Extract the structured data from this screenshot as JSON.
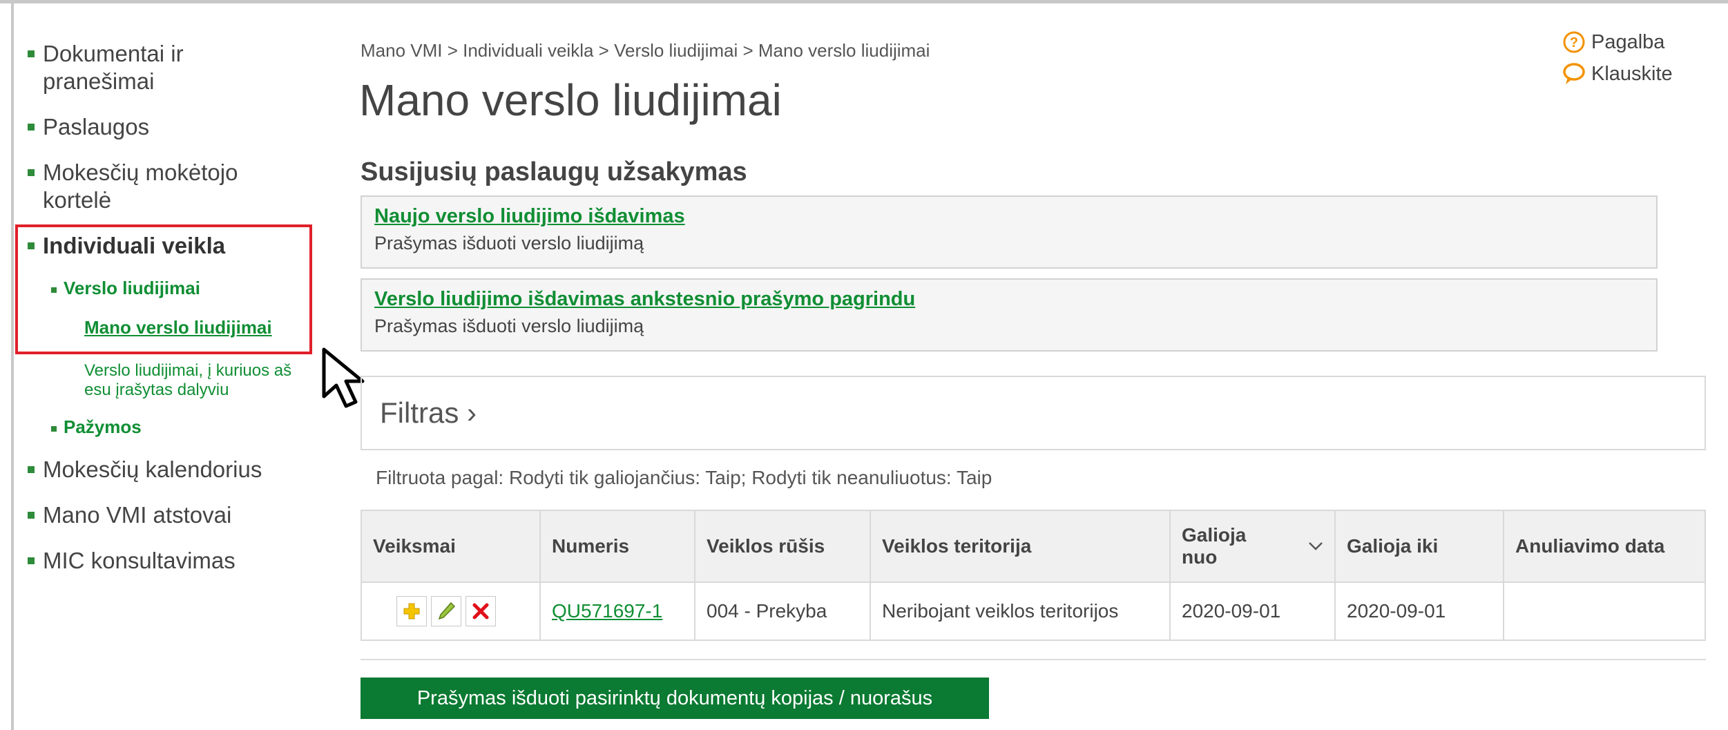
{
  "sidebar": {
    "items": [
      {
        "label": "Dokumentai ir pranešimai"
      },
      {
        "label": "Paslaugos"
      },
      {
        "label": "Mokesčių mokėtojo kortelė"
      },
      {
        "label": "Individuali veikla"
      },
      {
        "label": "Versl​o liudijimai"
      },
      {
        "label": "Mano verslo liudijimai"
      },
      {
        "label": "Verslo liudijimai, į kuriuos aš esu įrašytas dalyviu"
      },
      {
        "label": "Pažymos"
      },
      {
        "label": "Mokesčių kalendorius"
      },
      {
        "label": "Mano VMI atstovai"
      },
      {
        "label": "MIC konsultavimas"
      }
    ]
  },
  "header": {
    "breadcrumb": "Mano VMI > Individuali veikla > Verslo liudijimai > Mano verslo liudijimai",
    "title": "Mano verslo liudijimai",
    "help_label": "Pagalba",
    "ask_label": "Klauskite"
  },
  "services": {
    "title": "Susijusių paslaugų užsakymas",
    "items": [
      {
        "link": "Naujo verslo liudijimo išdavimas",
        "desc": "Prašymas išduoti verslo liudijimą"
      },
      {
        "link": "Verslo liudijimo išdavimas ankstesnio prašymo pagrindu",
        "desc": "Prašymas išduoti verslo liudijimą"
      }
    ]
  },
  "filter": {
    "label": "Filtras ›",
    "info": "Filtruota pagal: Rodyti tik galiojančius: Taip; Rodyti tik neanuliuotus: Taip"
  },
  "table": {
    "headers": [
      "Veiksmai",
      "Numeris",
      "Veiklos rūšis",
      "Veiklos teritorija",
      "Galioja nuo",
      "Galioja iki",
      "Anuliavimo data"
    ],
    "rows": [
      {
        "numeris": "QU571697-1",
        "rusis": "004 - Prekyba",
        "teritorija": "Neribojant veiklos teritorijos",
        "nuo": "2020-09-01",
        "iki": "2020-09-01",
        "anuliavimo": ""
      }
    ]
  },
  "actions": {
    "copies_button": "Prašymas išduoti pasirinktų dokumentų kopijas / nuorašus"
  },
  "colors": {
    "accent_green": "#108e34",
    "button_green": "#0b7a32",
    "highlight_red": "#e0202a"
  }
}
